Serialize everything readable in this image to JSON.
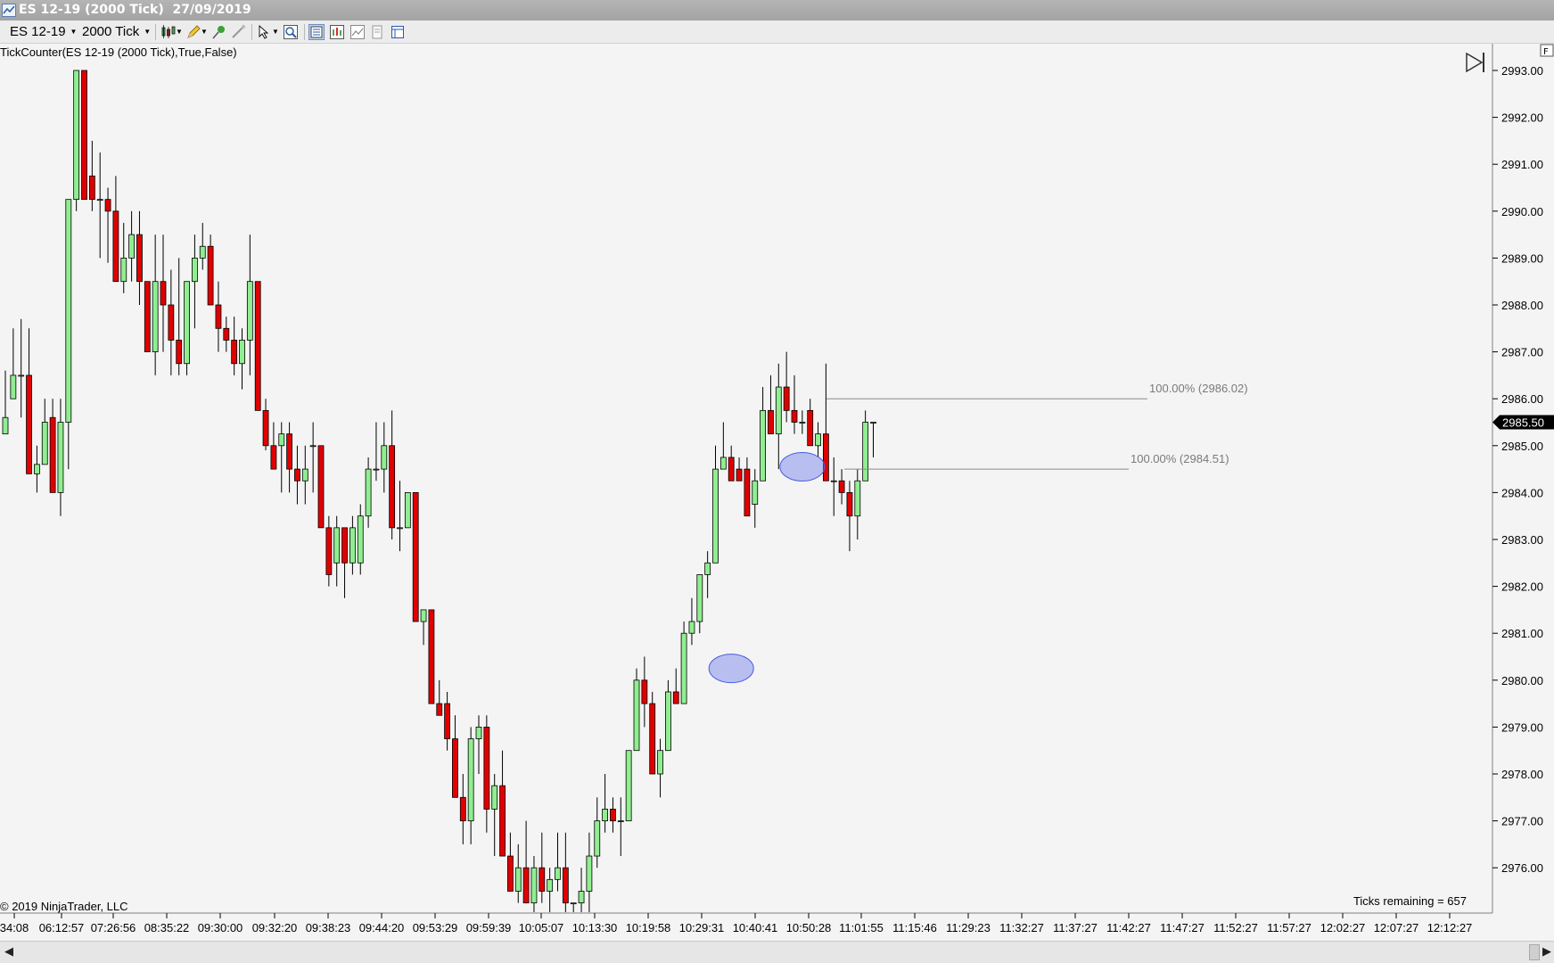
{
  "window": {
    "title": "ES 12-19 (2000 Tick)  27/09/2019"
  },
  "toolbar": {
    "instrument": "ES 12-19",
    "interval": "2000 Tick"
  },
  "chart": {
    "indicator_label": "TickCounter(ES  12-19  (2000  Tick),True,False)",
    "copyright": "© 2019 NinjaTrader, LLC",
    "ticks_remaining": "Ticks remaining = 657",
    "panel_corner_label": "F",
    "current_price": "2985.50",
    "colors": {
      "up": "#90ee90",
      "down": "#e00000",
      "outline": "#000000",
      "grid": "#c8c8c8",
      "price_marker": "#000000",
      "ellipse": "#4a5de0"
    },
    "icons": [
      "goto-end-icon"
    ],
    "price_ticks": [
      "2993.00",
      "2992.00",
      "2991.00",
      "2990.00",
      "2989.00",
      "2988.00",
      "2987.00",
      "2986.00",
      "2985.00",
      "2984.00",
      "2983.00",
      "2982.00",
      "2981.00",
      "2980.00",
      "2979.00",
      "2978.00",
      "2977.00",
      "2976.00"
    ],
    "time_ticks": [
      "34:08",
      "06:12:57",
      "07:26:56",
      "08:35:22",
      "09:30:00",
      "09:32:20",
      "09:38:23",
      "09:44:20",
      "09:53:29",
      "09:59:39",
      "10:05:07",
      "10:13:30",
      "10:19:58",
      "10:29:31",
      "10:40:41",
      "10:50:28",
      "11:01:55",
      "11:15:46",
      "11:29:23",
      "11:32:27",
      "11:37:27",
      "11:42:27",
      "11:47:27",
      "11:52:27",
      "11:57:27",
      "12:02:27",
      "12:07:27",
      "12:12:27"
    ],
    "fib_lines": [
      {
        "label": "100.00% (2986.02)",
        "price": 2986.0
      },
      {
        "label": "100.00% (2984.51)",
        "price": 2984.5
      }
    ],
    "highlight_ellipses": [
      {
        "bar_index": 92,
        "price": 2980.25
      },
      {
        "bar_index": 101,
        "price": 2984.55
      }
    ],
    "chart_data": {
      "type": "candlestick",
      "y_range": [
        2975,
        2993.5
      ],
      "bars": [
        {
          "o": 2985.25,
          "h": 2986.6,
          "l": 2985.25,
          "c": 2985.6
        },
        {
          "o": 2986.0,
          "h": 2987.5,
          "l": 2986.0,
          "c": 2986.5
        },
        {
          "o": 2986.5,
          "h": 2987.7,
          "l": 2985.6,
          "c": 2986.5
        },
        {
          "o": 2986.5,
          "h": 2987.5,
          "l": 2984.5,
          "c": 2984.4
        },
        {
          "o": 2984.4,
          "h": 2985.0,
          "l": 2984.0,
          "c": 2984.6
        },
        {
          "o": 2984.6,
          "h": 2986.0,
          "l": 2984.6,
          "c": 2985.5
        },
        {
          "o": 2985.6,
          "h": 2986.0,
          "l": 2984.0,
          "c": 2984.0
        },
        {
          "o": 2984.0,
          "h": 2986.0,
          "l": 2983.5,
          "c": 2985.5
        },
        {
          "o": 2985.5,
          "h": 2989.0,
          "l": 2984.5,
          "c": 2990.25
        },
        {
          "o": 2990.25,
          "h": 2991.5,
          "l": 2990.0,
          "c": 2993.0
        },
        {
          "o": 2993.0,
          "h": 2993.0,
          "l": 2990.25,
          "c": 2990.25
        },
        {
          "o": 2990.75,
          "h": 2991.5,
          "l": 2990.0,
          "c": 2990.25
        },
        {
          "o": 2990.25,
          "h": 2991.25,
          "l": 2989.0,
          "c": 2990.25
        },
        {
          "o": 2990.25,
          "h": 2990.5,
          "l": 2988.9,
          "c": 2990.0
        },
        {
          "o": 2990.0,
          "h": 2990.75,
          "l": 2988.5,
          "c": 2988.5
        },
        {
          "o": 2988.5,
          "h": 2989.75,
          "l": 2988.25,
          "c": 2989.0
        },
        {
          "o": 2989.0,
          "h": 2990.0,
          "l": 2988.5,
          "c": 2989.5
        },
        {
          "o": 2989.5,
          "h": 2990.0,
          "l": 2988.0,
          "c": 2988.5
        },
        {
          "o": 2988.5,
          "h": 2988.5,
          "l": 2987.0,
          "c": 2987.0
        },
        {
          "o": 2987.0,
          "h": 2989.5,
          "l": 2986.5,
          "c": 2988.5
        },
        {
          "o": 2988.5,
          "h": 2989.5,
          "l": 2987.0,
          "c": 2988.0
        },
        {
          "o": 2988.0,
          "h": 2988.75,
          "l": 2986.5,
          "c": 2987.25
        },
        {
          "o": 2987.25,
          "h": 2989.0,
          "l": 2986.5,
          "c": 2986.75
        },
        {
          "o": 2986.75,
          "h": 2988.5,
          "l": 2986.5,
          "c": 2988.5
        },
        {
          "o": 2988.5,
          "h": 2989.5,
          "l": 2987.5,
          "c": 2989.0
        },
        {
          "o": 2989.0,
          "h": 2989.75,
          "l": 2988.75,
          "c": 2989.25
        },
        {
          "o": 2989.25,
          "h": 2989.5,
          "l": 2988.0,
          "c": 2988.0
        },
        {
          "o": 2988.0,
          "h": 2988.5,
          "l": 2987.0,
          "c": 2987.5
        },
        {
          "o": 2987.5,
          "h": 2987.75,
          "l": 2987.0,
          "c": 2987.25
        },
        {
          "o": 2987.25,
          "h": 2987.75,
          "l": 2986.5,
          "c": 2986.75
        },
        {
          "o": 2986.75,
          "h": 2987.5,
          "l": 2986.2,
          "c": 2987.25
        },
        {
          "o": 2987.25,
          "h": 2989.5,
          "l": 2986.5,
          "c": 2988.5
        },
        {
          "o": 2988.5,
          "h": 2988.5,
          "l": 2985.75,
          "c": 2985.75
        },
        {
          "o": 2985.75,
          "h": 2986.0,
          "l": 2984.9,
          "c": 2985.0
        },
        {
          "o": 2985.0,
          "h": 2985.5,
          "l": 2984.5,
          "c": 2984.5
        },
        {
          "o": 2985.0,
          "h": 2985.5,
          "l": 2984.0,
          "c": 2985.25
        },
        {
          "o": 2985.25,
          "h": 2985.5,
          "l": 2984.0,
          "c": 2984.5
        },
        {
          "o": 2984.5,
          "h": 2985.0,
          "l": 2983.75,
          "c": 2984.25
        },
        {
          "o": 2984.25,
          "h": 2985.0,
          "l": 2983.75,
          "c": 2984.5
        },
        {
          "o": 2985.0,
          "h": 2985.5,
          "l": 2984.0,
          "c": 2985.0
        },
        {
          "o": 2985.0,
          "h": 2985.0,
          "l": 2983.25,
          "c": 2983.25
        },
        {
          "o": 2983.25,
          "h": 2983.5,
          "l": 2982.0,
          "c": 2982.25
        },
        {
          "o": 2982.5,
          "h": 2983.5,
          "l": 2982.0,
          "c": 2983.25
        },
        {
          "o": 2983.25,
          "h": 2983.25,
          "l": 2981.75,
          "c": 2982.5
        },
        {
          "o": 2982.5,
          "h": 2983.5,
          "l": 2982.25,
          "c": 2983.25
        },
        {
          "o": 2982.5,
          "h": 2983.75,
          "l": 2982.25,
          "c": 2983.5
        },
        {
          "o": 2983.5,
          "h": 2984.75,
          "l": 2983.25,
          "c": 2984.5
        },
        {
          "o": 2984.5,
          "h": 2985.5,
          "l": 2984.25,
          "c": 2984.5
        },
        {
          "o": 2984.5,
          "h": 2985.5,
          "l": 2984.0,
          "c": 2985.0
        },
        {
          "o": 2985.0,
          "h": 2985.75,
          "l": 2983.0,
          "c": 2983.25
        },
        {
          "o": 2983.25,
          "h": 2984.25,
          "l": 2982.75,
          "c": 2983.25
        },
        {
          "o": 2983.25,
          "h": 2984.0,
          "l": 2983.25,
          "c": 2984.0
        },
        {
          "o": 2984.0,
          "h": 2984.0,
          "l": 2981.25,
          "c": 2981.25
        },
        {
          "o": 2981.25,
          "h": 2981.5,
          "l": 2980.75,
          "c": 2981.5
        },
        {
          "o": 2981.5,
          "h": 2981.5,
          "l": 2979.5,
          "c": 2979.5
        },
        {
          "o": 2979.5,
          "h": 2980.0,
          "l": 2979.25,
          "c": 2979.25
        },
        {
          "o": 2979.5,
          "h": 2979.75,
          "l": 2978.5,
          "c": 2978.75
        },
        {
          "o": 2978.75,
          "h": 2979.25,
          "l": 2977.5,
          "c": 2977.5
        },
        {
          "o": 2977.5,
          "h": 2978.0,
          "l": 2976.5,
          "c": 2977.0
        },
        {
          "o": 2977.0,
          "h": 2979.0,
          "l": 2976.5,
          "c": 2978.75
        },
        {
          "o": 2978.75,
          "h": 2979.25,
          "l": 2978.0,
          "c": 2979.0
        },
        {
          "o": 2979.0,
          "h": 2979.25,
          "l": 2976.75,
          "c": 2977.25
        },
        {
          "o": 2977.25,
          "h": 2978.0,
          "l": 2976.25,
          "c": 2977.75
        },
        {
          "o": 2977.75,
          "h": 2978.5,
          "l": 2976.25,
          "c": 2976.25
        },
        {
          "o": 2976.25,
          "h": 2976.75,
          "l": 2975.5,
          "c": 2975.5
        },
        {
          "o": 2975.5,
          "h": 2976.5,
          "l": 2975.25,
          "c": 2976.0
        },
        {
          "o": 2976.0,
          "h": 2977.0,
          "l": 2975.25,
          "c": 2975.25
        },
        {
          "o": 2975.25,
          "h": 2976.25,
          "l": 2975.0,
          "c": 2976.0
        },
        {
          "o": 2976.0,
          "h": 2976.75,
          "l": 2975.25,
          "c": 2975.5
        },
        {
          "o": 2975.5,
          "h": 2976.0,
          "l": 2975.0,
          "c": 2975.75
        },
        {
          "o": 2975.75,
          "h": 2976.75,
          "l": 2975.5,
          "c": 2976.0
        },
        {
          "o": 2976.0,
          "h": 2976.75,
          "l": 2975.0,
          "c": 2975.25
        },
        {
          "o": 2975.25,
          "h": 2975.25,
          "l": 2975.0,
          "c": 2975.25
        },
        {
          "o": 2975.25,
          "h": 2976.0,
          "l": 2975.0,
          "c": 2975.5
        },
        {
          "o": 2975.5,
          "h": 2976.75,
          "l": 2975.0,
          "c": 2976.25
        },
        {
          "o": 2976.25,
          "h": 2977.5,
          "l": 2976.0,
          "c": 2977.0
        },
        {
          "o": 2977.0,
          "h": 2978.0,
          "l": 2976.75,
          "c": 2977.25
        },
        {
          "o": 2977.25,
          "h": 2977.5,
          "l": 2976.75,
          "c": 2977.0
        },
        {
          "o": 2977.0,
          "h": 2977.5,
          "l": 2976.25,
          "c": 2977.0
        },
        {
          "o": 2977.0,
          "h": 2978.5,
          "l": 2977.0,
          "c": 2978.5
        },
        {
          "o": 2978.5,
          "h": 2980.25,
          "l": 2978.5,
          "c": 2980.0
        },
        {
          "o": 2980.0,
          "h": 2980.5,
          "l": 2979.0,
          "c": 2979.5
        },
        {
          "o": 2979.5,
          "h": 2979.75,
          "l": 2978.0,
          "c": 2978.0
        },
        {
          "o": 2978.0,
          "h": 2978.75,
          "l": 2977.5,
          "c": 2978.5
        },
        {
          "o": 2978.5,
          "h": 2980.0,
          "l": 2978.5,
          "c": 2979.75
        },
        {
          "o": 2979.75,
          "h": 2980.25,
          "l": 2979.5,
          "c": 2979.5
        },
        {
          "o": 2979.5,
          "h": 2981.25,
          "l": 2979.5,
          "c": 2981.0
        },
        {
          "o": 2981.0,
          "h": 2981.75,
          "l": 2980.75,
          "c": 2981.25
        },
        {
          "o": 2981.25,
          "h": 2982.25,
          "l": 2981.0,
          "c": 2982.25
        },
        {
          "o": 2982.25,
          "h": 2982.75,
          "l": 2981.75,
          "c": 2982.5
        },
        {
          "o": 2982.5,
          "h": 2985.0,
          "l": 2982.5,
          "c": 2984.5
        },
        {
          "o": 2984.5,
          "h": 2985.5,
          "l": 2984.5,
          "c": 2984.75
        },
        {
          "o": 2984.75,
          "h": 2985.0,
          "l": 2984.25,
          "c": 2984.25
        },
        {
          "o": 2984.5,
          "h": 2984.75,
          "l": 2984.25,
          "c": 2984.25
        },
        {
          "o": 2984.5,
          "h": 2984.75,
          "l": 2983.5,
          "c": 2983.5
        },
        {
          "o": 2983.75,
          "h": 2984.5,
          "l": 2983.25,
          "c": 2984.25
        },
        {
          "o": 2984.25,
          "h": 2986.25,
          "l": 2984.25,
          "c": 2985.75
        },
        {
          "o": 2985.75,
          "h": 2986.5,
          "l": 2985.25,
          "c": 2985.25
        },
        {
          "o": 2985.25,
          "h": 2986.75,
          "l": 2984.5,
          "c": 2986.25
        },
        {
          "o": 2986.25,
          "h": 2987.0,
          "l": 2985.5,
          "c": 2985.75
        },
        {
          "o": 2985.75,
          "h": 2986.5,
          "l": 2985.25,
          "c": 2985.5
        },
        {
          "o": 2985.5,
          "h": 2985.75,
          "l": 2985.25,
          "c": 2985.5
        },
        {
          "o": 2985.75,
          "h": 2986.0,
          "l": 2985.0,
          "c": 2985.0
        },
        {
          "o": 2985.0,
          "h": 2985.5,
          "l": 2984.75,
          "c": 2985.25
        },
        {
          "o": 2985.25,
          "h": 2986.75,
          "l": 2984.25,
          "c": 2984.25
        },
        {
          "o": 2984.25,
          "h": 2984.75,
          "l": 2983.5,
          "c": 2984.25
        },
        {
          "o": 2984.25,
          "h": 2984.5,
          "l": 2983.75,
          "c": 2984.0
        },
        {
          "o": 2984.0,
          "h": 2984.25,
          "l": 2982.75,
          "c": 2983.5
        },
        {
          "o": 2983.5,
          "h": 2984.5,
          "l": 2983.0,
          "c": 2984.25
        },
        {
          "o": 2984.25,
          "h": 2985.75,
          "l": 2984.25,
          "c": 2985.5
        },
        {
          "o": 2985.5,
          "h": 2985.5,
          "l": 2984.75,
          "c": 2985.5
        }
      ]
    }
  }
}
